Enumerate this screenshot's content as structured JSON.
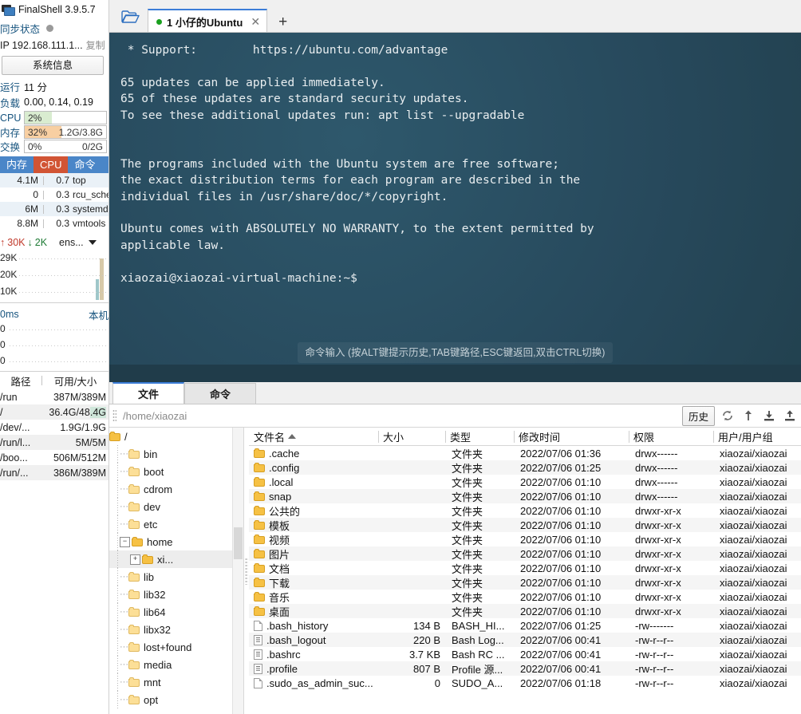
{
  "app": {
    "title": "FinalShell 3.9.5.7"
  },
  "sidebar": {
    "sync_label": "同步状态",
    "ip_label": "IP 192.168.111.1...",
    "copy_label": "复制",
    "sysinfo_button": "系统信息",
    "uptime_key": "运行",
    "uptime_value": "11 分",
    "load_key": "负载",
    "load_value": "0.00, 0.14, 0.19",
    "meters": [
      {
        "name": "CPU",
        "percent": "2%",
        "detail": "",
        "fill_pct": 2,
        "color": "#d9ecd0"
      },
      {
        "name": "内存",
        "percent": "32%",
        "detail": "1.2G/3.8G",
        "fill_pct": 32,
        "color": "#f8cfa2"
      },
      {
        "name": "交换",
        "percent": "0%",
        "detail": "0/2G",
        "fill_pct": 0,
        "color": "#f8cfa2"
      }
    ],
    "proc_tabs": [
      {
        "label": "内存",
        "active": false
      },
      {
        "label": "CPU",
        "active": true
      },
      {
        "label": "命令",
        "active": false
      }
    ],
    "processes": [
      {
        "mem": "4.1M",
        "cpu": "0.7",
        "cmd": "top"
      },
      {
        "mem": "0",
        "cpu": "0.3",
        "cmd": "rcu_sche"
      },
      {
        "mem": "6M",
        "cpu": "0.3",
        "cmd": "systemd"
      },
      {
        "mem": "8.8M",
        "cpu": "0.3",
        "cmd": "vmtools"
      }
    ],
    "net": {
      "up": "30K",
      "down": "2K",
      "interface": "ens...",
      "ticks": [
        "29K",
        "20K",
        "10K"
      ]
    },
    "ping": {
      "latency": "0ms",
      "host": "本机",
      "ticks": [
        "0",
        "0",
        "0"
      ]
    },
    "disk": {
      "header": [
        "路径",
        "可用/大小"
      ],
      "rows": [
        {
          "path": "/run",
          "usage": "387M/389M"
        },
        {
          "path": "/",
          "usage": "36.4G/48.4G"
        },
        {
          "path": "/dev/...",
          "usage": "1.9G/1.9G"
        },
        {
          "path": "/run/l...",
          "usage": "5M/5M"
        },
        {
          "path": "/boo...",
          "usage": "506M/512M"
        },
        {
          "path": "/run/...",
          "usage": "386M/389M"
        }
      ]
    }
  },
  "tabbar": {
    "tab_label": "1 小仔的Ubuntu",
    "close_label": "✕",
    "new_tab_label": "+"
  },
  "terminal": {
    "lines": [
      " * Support:        https://ubuntu.com/advantage",
      "",
      "65 updates can be applied immediately.",
      "65 of these updates are standard security updates.",
      "To see these additional updates run: apt list --upgradable",
      "",
      "",
      "The programs included with the Ubuntu system are free software;",
      "the exact distribution terms for each program are described in the",
      "individual files in /usr/share/doc/*/copyright.",
      "",
      "Ubuntu comes with ABSOLUTELY NO WARRANTY, to the extent permitted by",
      "applicable law.",
      "",
      "xiaozai@xiaozai-virtual-machine:~$"
    ],
    "input_hint": "命令输入 (按ALT键提示历史,TAB键路径,ESC键返回,双击CTRL切换)"
  },
  "lower": {
    "tabs": [
      {
        "label": "文件",
        "active": true
      },
      {
        "label": "命令",
        "active": false
      }
    ],
    "path_value": "/home/xiaozai",
    "history_button": "历史",
    "toolbar_icons": [
      "refresh-icon",
      "upload-arrow-icon",
      "download-icon",
      "upload-icon"
    ],
    "tree": [
      {
        "label": "/",
        "depth": 0,
        "toggle": "",
        "selected": false,
        "light": false
      },
      {
        "label": "bin",
        "depth": 1,
        "toggle": "",
        "selected": false,
        "light": true
      },
      {
        "label": "boot",
        "depth": 1,
        "toggle": "",
        "selected": false,
        "light": true
      },
      {
        "label": "cdrom",
        "depth": 1,
        "toggle": "",
        "selected": false,
        "light": true
      },
      {
        "label": "dev",
        "depth": 1,
        "toggle": "",
        "selected": false,
        "light": true
      },
      {
        "label": "etc",
        "depth": 1,
        "toggle": "",
        "selected": false,
        "light": true
      },
      {
        "label": "home",
        "depth": 1,
        "toggle": "−",
        "selected": false,
        "light": false
      },
      {
        "label": "xi...",
        "depth": 2,
        "toggle": "+",
        "selected": true,
        "light": false
      },
      {
        "label": "lib",
        "depth": 1,
        "toggle": "",
        "selected": false,
        "light": true
      },
      {
        "label": "lib32",
        "depth": 1,
        "toggle": "",
        "selected": false,
        "light": true
      },
      {
        "label": "lib64",
        "depth": 1,
        "toggle": "",
        "selected": false,
        "light": true
      },
      {
        "label": "libx32",
        "depth": 1,
        "toggle": "",
        "selected": false,
        "light": true
      },
      {
        "label": "lost+found",
        "depth": 1,
        "toggle": "",
        "selected": false,
        "light": true
      },
      {
        "label": "media",
        "depth": 1,
        "toggle": "",
        "selected": false,
        "light": true
      },
      {
        "label": "mnt",
        "depth": 1,
        "toggle": "",
        "selected": false,
        "light": true
      },
      {
        "label": "opt",
        "depth": 1,
        "toggle": "",
        "selected": false,
        "light": true
      }
    ],
    "columns": [
      "文件名",
      "大小",
      "类型",
      "修改时间",
      "权限",
      "用户/用户组"
    ],
    "files": [
      {
        "name": ".cache",
        "size": "",
        "type": "文件夹",
        "mtime": "2022/07/06 01:36",
        "perm": "drwx------",
        "user": "xiaozai/xiaozai",
        "icon": "folder"
      },
      {
        "name": ".config",
        "size": "",
        "type": "文件夹",
        "mtime": "2022/07/06 01:25",
        "perm": "drwx------",
        "user": "xiaozai/xiaozai",
        "icon": "folder"
      },
      {
        "name": ".local",
        "size": "",
        "type": "文件夹",
        "mtime": "2022/07/06 01:10",
        "perm": "drwx------",
        "user": "xiaozai/xiaozai",
        "icon": "folder"
      },
      {
        "name": "snap",
        "size": "",
        "type": "文件夹",
        "mtime": "2022/07/06 01:10",
        "perm": "drwx------",
        "user": "xiaozai/xiaozai",
        "icon": "folder"
      },
      {
        "name": "公共的",
        "size": "",
        "type": "文件夹",
        "mtime": "2022/07/06 01:10",
        "perm": "drwxr-xr-x",
        "user": "xiaozai/xiaozai",
        "icon": "folder"
      },
      {
        "name": "模板",
        "size": "",
        "type": "文件夹",
        "mtime": "2022/07/06 01:10",
        "perm": "drwxr-xr-x",
        "user": "xiaozai/xiaozai",
        "icon": "folder"
      },
      {
        "name": "视频",
        "size": "",
        "type": "文件夹",
        "mtime": "2022/07/06 01:10",
        "perm": "drwxr-xr-x",
        "user": "xiaozai/xiaozai",
        "icon": "folder"
      },
      {
        "name": "图片",
        "size": "",
        "type": "文件夹",
        "mtime": "2022/07/06 01:10",
        "perm": "drwxr-xr-x",
        "user": "xiaozai/xiaozai",
        "icon": "folder"
      },
      {
        "name": "文档",
        "size": "",
        "type": "文件夹",
        "mtime": "2022/07/06 01:10",
        "perm": "drwxr-xr-x",
        "user": "xiaozai/xiaozai",
        "icon": "folder"
      },
      {
        "name": "下载",
        "size": "",
        "type": "文件夹",
        "mtime": "2022/07/06 01:10",
        "perm": "drwxr-xr-x",
        "user": "xiaozai/xiaozai",
        "icon": "folder"
      },
      {
        "name": "音乐",
        "size": "",
        "type": "文件夹",
        "mtime": "2022/07/06 01:10",
        "perm": "drwxr-xr-x",
        "user": "xiaozai/xiaozai",
        "icon": "folder"
      },
      {
        "name": "桌面",
        "size": "",
        "type": "文件夹",
        "mtime": "2022/07/06 01:10",
        "perm": "drwxr-xr-x",
        "user": "xiaozai/xiaozai",
        "icon": "folder"
      },
      {
        "name": ".bash_history",
        "size": "134 B",
        "type": "BASH_HI...",
        "mtime": "2022/07/06 01:25",
        "perm": "-rw-------",
        "user": "xiaozai/xiaozai",
        "icon": "blank"
      },
      {
        "name": ".bash_logout",
        "size": "220 B",
        "type": "Bash Log...",
        "mtime": "2022/07/06 00:41",
        "perm": "-rw-r--r--",
        "user": "xiaozai/xiaozai",
        "icon": "doc"
      },
      {
        "name": ".bashrc",
        "size": "3.7 KB",
        "type": "Bash RC ...",
        "mtime": "2022/07/06 00:41",
        "perm": "-rw-r--r--",
        "user": "xiaozai/xiaozai",
        "icon": "doc"
      },
      {
        "name": ".profile",
        "size": "807 B",
        "type": "Profile 源...",
        "mtime": "2022/07/06 00:41",
        "perm": "-rw-r--r--",
        "user": "xiaozai/xiaozai",
        "icon": "doc"
      },
      {
        "name": ".sudo_as_admin_suc...",
        "size": "0",
        "type": "SUDO_A...",
        "mtime": "2022/07/06 01:18",
        "perm": "-rw-r--r--",
        "user": "xiaozai/xiaozai",
        "icon": "blank"
      }
    ]
  }
}
